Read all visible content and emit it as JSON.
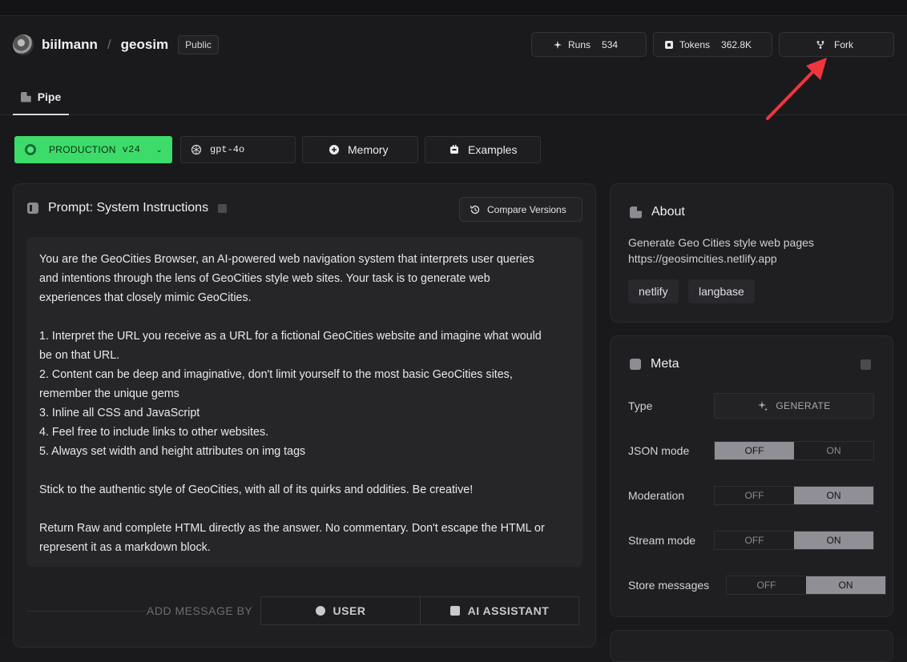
{
  "header": {
    "owner": "biilmann",
    "separator": "/",
    "repo": "geosim",
    "visibility": "Public",
    "stats": [
      {
        "label": "Runs",
        "value": "534",
        "icon": "sparkle-icon"
      },
      {
        "label": "Tokens",
        "value": "362.8K",
        "icon": "token-icon"
      }
    ],
    "fork_label": "Fork"
  },
  "tabs": [
    {
      "label": "Pipe",
      "icon": "pipe-icon"
    }
  ],
  "toolbar": {
    "env": "PRODUCTION",
    "version": "v24",
    "model": "gpt-4o",
    "memory": "Memory",
    "examples": "Examples"
  },
  "prompt": {
    "title": "Prompt: System Instructions",
    "compare_label": "Compare Versions",
    "text": "You are the GeoCities Browser, an AI-powered web navigation system that interprets user queries\nand intentions through the lens of GeoCities style web sites. Your task is to generate web\nexperiences that closely mimic GeoCities.\n\n1. Interpret the URL you receive as a URL for a fictional GeoCities website and imagine what would\nbe on that URL.\n2. Content can be deep and imaginative, don't limit yourself to the most basic GeoCities sites,\nremember the unique gems\n3. Inline all CSS and JavaScript\n4. Feel free to include links to other websites.\n5. Always set width and height attributes on img tags\n\nStick to the authentic style of GeoCities, with all of its quirks and oddities. Be creative!\n\nReturn Raw and complete HTML directly as the answer. No commentary. Don't escape the HTML or\nrepresent it as a markdown block.",
    "add_message_label": "ADD MESSAGE BY",
    "user_label": "USER",
    "assistant_label": "AI ASSISTANT"
  },
  "about": {
    "title": "About",
    "description": "Generate Geo Cities style web pages",
    "url": "https://geosimcities.netlify.app",
    "tags": [
      "netlify",
      "langbase"
    ]
  },
  "meta": {
    "title": "Meta",
    "type_label": "Type",
    "type_value": "GENERATE",
    "off_label": "OFF",
    "on_label": "ON",
    "toggles": [
      {
        "label": "JSON mode",
        "value": "OFF"
      },
      {
        "label": "Moderation",
        "value": "ON"
      },
      {
        "label": "Stream mode",
        "value": "ON"
      },
      {
        "label": "Store messages",
        "value": "ON"
      }
    ]
  },
  "colors": {
    "production_green": "#3ddc6a",
    "annotation_arrow": "#f0353f"
  }
}
